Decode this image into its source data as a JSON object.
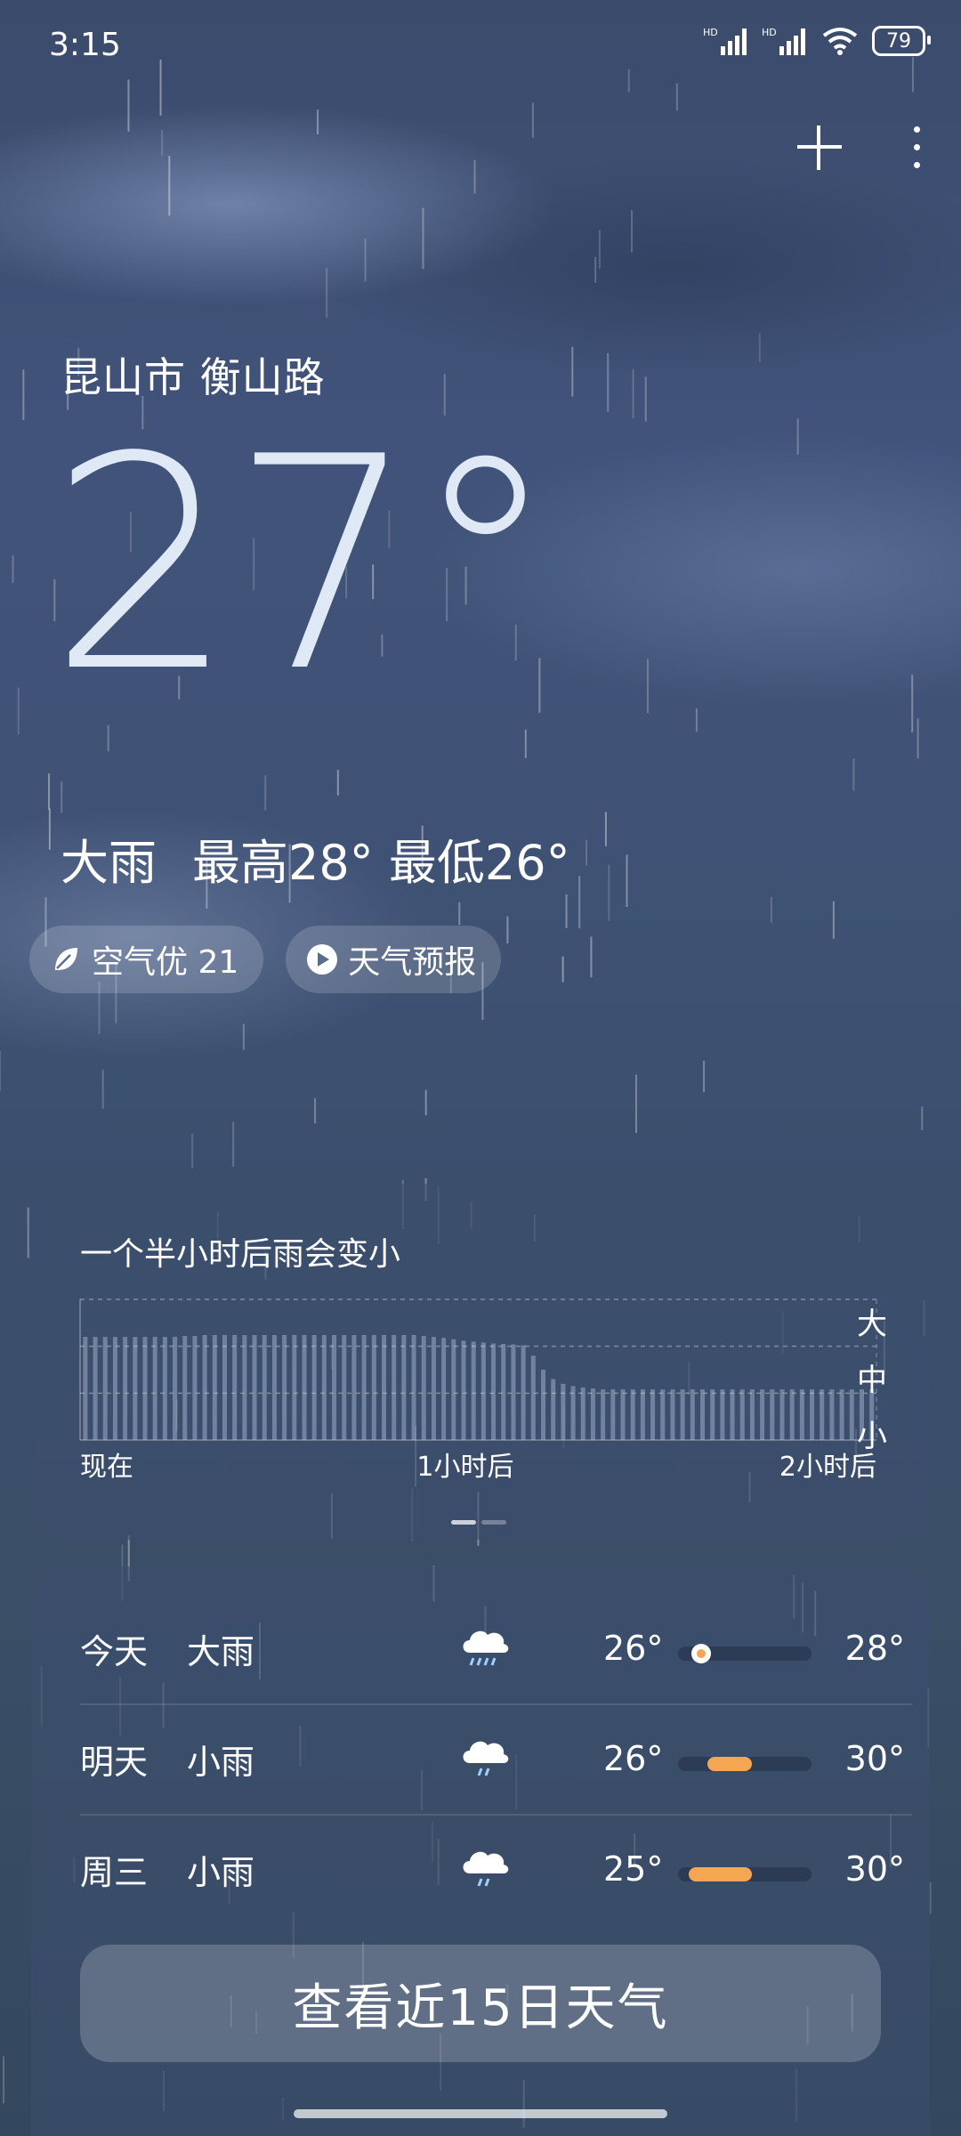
{
  "status_bar": {
    "time": "3:15",
    "battery": "79",
    "signal_1": "HD",
    "signal_2": "HD"
  },
  "header": {
    "add_icon": "plus-icon",
    "more_icon": "more-vertical-icon"
  },
  "location": "昆山市 衡山路",
  "current": {
    "temperature": "27°",
    "condition": "大雨",
    "high_low": "最高28° 最低26°"
  },
  "pills": {
    "air_quality": "空气优 21",
    "forecast_video": "天气预报"
  },
  "rain_forecast": {
    "title": "一个半小时后雨会变小",
    "levels": [
      "大",
      "中",
      "小"
    ],
    "x_labels": [
      "现在",
      "1小时后",
      "2小时后"
    ]
  },
  "chart_data": {
    "type": "bar",
    "title": "一个半小时后雨会变小",
    "xlabel": "",
    "ylabel": "",
    "x_ticks": [
      "现在",
      "1小时后",
      "2小时后"
    ],
    "y_levels": [
      "小",
      "中",
      "大"
    ],
    "ylim": [
      0,
      3
    ],
    "values": [
      2.2,
      2.2,
      2.2,
      2.2,
      2.2,
      2.2,
      2.2,
      2.2,
      2.2,
      2.2,
      2.22,
      2.22,
      2.24,
      2.24,
      2.24,
      2.24,
      2.24,
      2.24,
      2.24,
      2.24,
      2.24,
      2.24,
      2.24,
      2.24,
      2.24,
      2.24,
      2.24,
      2.24,
      2.24,
      2.24,
      2.24,
      2.24,
      2.24,
      2.24,
      2.22,
      2.2,
      2.18,
      2.15,
      2.12,
      2.1,
      2.08,
      2.06,
      2.05,
      2.04,
      2.02,
      1.8,
      1.5,
      1.3,
      1.2,
      1.15,
      1.12,
      1.1,
      1.08,
      1.08,
      1.08,
      1.08,
      1.08,
      1.08,
      1.08,
      1.08,
      1.08,
      1.08,
      1.08,
      1.08,
      1.08,
      1.08,
      1.08,
      1.08,
      1.08,
      1.08,
      1.08,
      1.08,
      1.08,
      1.08,
      1.08,
      1.08,
      1.08,
      1.08,
      1.08,
      1.08
    ]
  },
  "daily": [
    {
      "day": "今天",
      "condition": "大雨",
      "icon": "heavy-rain-icon",
      "low": "26°",
      "high": "28°",
      "range_start": 0.05,
      "range_end": 0.3,
      "now": 0.17,
      "is_today": true
    },
    {
      "day": "明天",
      "condition": "小雨",
      "icon": "light-rain-icon",
      "low": "26°",
      "high": "30°",
      "range_start": 0.22,
      "range_end": 0.55,
      "is_today": false
    },
    {
      "day": "周三",
      "condition": "小雨",
      "icon": "light-rain-icon",
      "low": "25°",
      "high": "30°",
      "range_start": 0.08,
      "range_end": 0.55,
      "is_today": false
    }
  ],
  "cta_label": "查看近15日天气",
  "colors": {
    "accent": "#f4a653",
    "card": "#3c4e6c"
  }
}
